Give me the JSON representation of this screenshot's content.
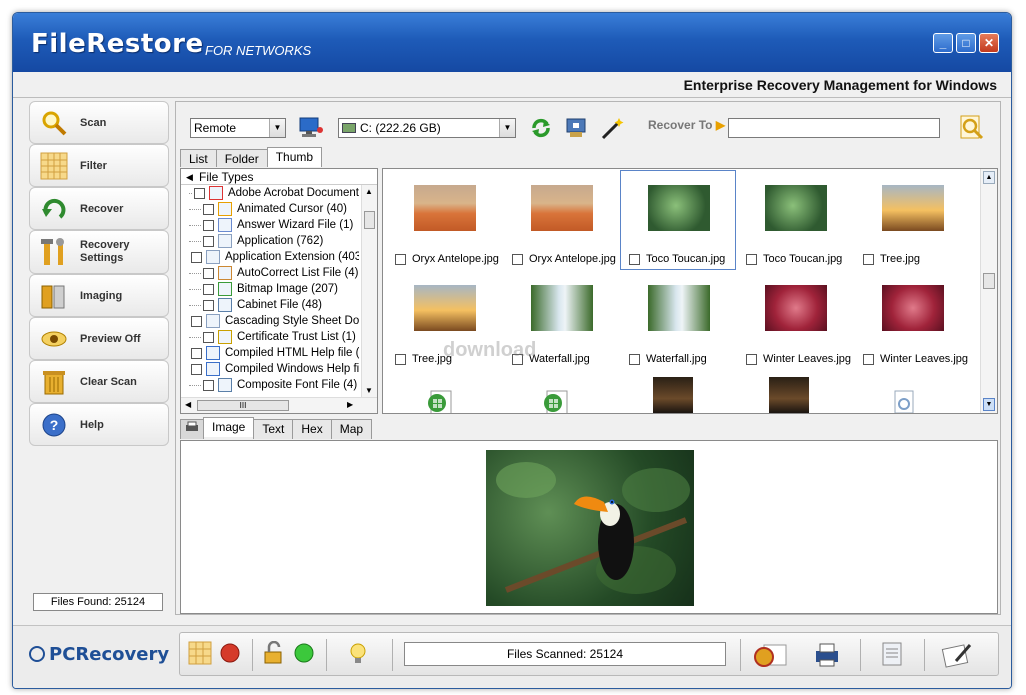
{
  "window": {
    "title_main": "FileRestore",
    "title_sub": "FOR NETWORKS",
    "minimize": "_",
    "maximize": "□",
    "close": "✕",
    "tagline": "Enterprise Recovery Management for Windows"
  },
  "sidebar": {
    "items": [
      {
        "label": "Scan",
        "icon": "magnifier-icon"
      },
      {
        "label": "Filter",
        "icon": "grid-filter-icon"
      },
      {
        "label": "Recover",
        "icon": "recover-arrow-icon"
      },
      {
        "label": "Recovery Settings",
        "icon": "tools-icon"
      },
      {
        "label": "Imaging",
        "icon": "disk-image-icon"
      },
      {
        "label": "Preview Off",
        "icon": "eye-icon"
      },
      {
        "label": "Clear Scan",
        "icon": "trash-icon"
      },
      {
        "label": "Help",
        "icon": "help-icon"
      }
    ],
    "files_found": "Files Found: 25124"
  },
  "toolbar": {
    "source": "Remote",
    "drive": "C: (222.26 GB)",
    "recover_to_label": "Recover To",
    "recover_to_value": ""
  },
  "view_tabs": [
    "List",
    "Folder",
    "Thumb"
  ],
  "tree": {
    "header": "File Types",
    "items": [
      "Adobe Acrobat Document",
      "Animated Cursor (40)",
      "Answer Wizard File (1)",
      "Application (762)",
      "Application Extension (403",
      "AutoCorrect List File (4)",
      "Bitmap Image (207)",
      "Cabinet File (48)",
      "Cascading Style Sheet Do",
      "Certificate Trust List (1)",
      "Compiled HTML Help file (",
      "Compiled Windows Help fi",
      "Composite Font File (4)"
    ],
    "hscroll_label": "III"
  },
  "thumbnails": [
    {
      "caption": "Oryx Antelope.jpg",
      "kind": "desert"
    },
    {
      "caption": "Oryx Antelope.jpg",
      "kind": "desert"
    },
    {
      "caption": "Toco Toucan.jpg",
      "kind": "toucan"
    },
    {
      "caption": "Toco Toucan.jpg",
      "kind": "toucan"
    },
    {
      "caption": "Tree.jpg",
      "kind": "tree"
    },
    {
      "caption": "Tree.jpg",
      "kind": "tree"
    },
    {
      "caption": "Waterfall.jpg",
      "kind": "waterfall"
    },
    {
      "caption": "Waterfall.jpg",
      "kind": "waterfall"
    },
    {
      "caption": "Winter Leaves.jpg",
      "kind": "leaves"
    },
    {
      "caption": "Winter Leaves.jpg",
      "kind": "leaves"
    }
  ],
  "watermark": "download",
  "preview_tabs": [
    "Image",
    "Text",
    "Hex",
    "Map"
  ],
  "bottom": {
    "brand": "PCRecovery",
    "files_scanned": "Files Scanned: 25124"
  }
}
